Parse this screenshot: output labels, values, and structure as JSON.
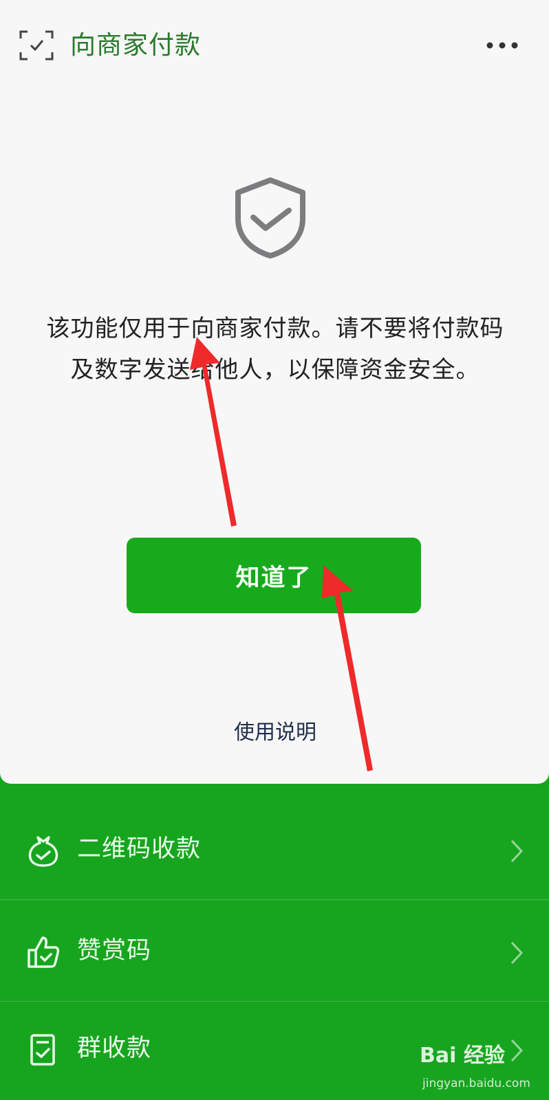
{
  "header": {
    "title": "向商家付款",
    "scan_icon": "scan-frame-icon",
    "more_icon": "more-dots-icon"
  },
  "notice": {
    "icon": "shield-check-icon",
    "text": "该功能仅用于向商家付款。请不要将付款码及数字发送给他人，以保障资金安全。"
  },
  "ack_button": {
    "label": "知道了"
  },
  "help_link": {
    "label": "使用说明"
  },
  "menu": {
    "items": [
      {
        "label": "二维码收款",
        "icon": "money-bag-icon"
      },
      {
        "label": "赞赏码",
        "icon": "thumbs-up-icon"
      },
      {
        "label": "群收款",
        "icon": "group-bill-icon"
      }
    ]
  },
  "watermark": {
    "logo": "Bai 经验",
    "url": "jingyan.baidu.com"
  },
  "colors": {
    "brand_green": "#16aa1c",
    "menu_bg": "#17a51f",
    "card_bg": "#f7f7f7",
    "annotation_red": "#ee2a2a"
  }
}
